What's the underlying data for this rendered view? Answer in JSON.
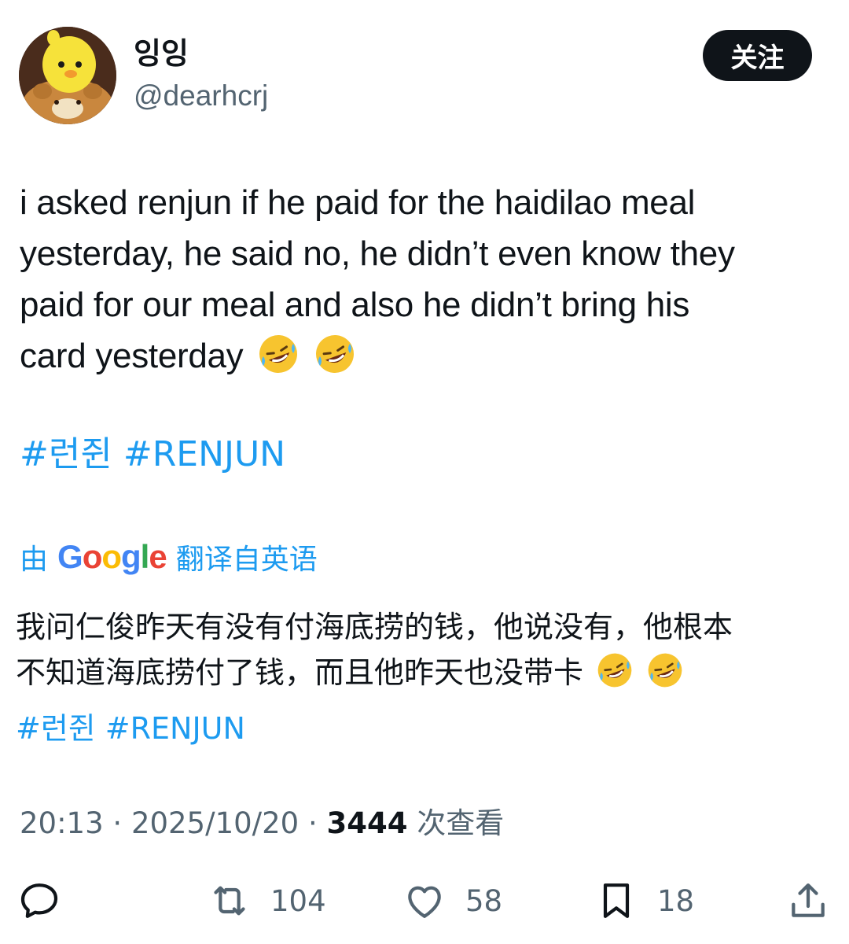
{
  "user": {
    "display_name": "잉잉",
    "handle": "@dearhcrj"
  },
  "follow_label": "关注",
  "tweet": {
    "lines": [
      "i asked renjun if he paid for the haidilao meal",
      "yesterday, he said no, he didn’t even know they",
      "paid for our meal and also he didn’t bring his",
      "card yesterday"
    ],
    "hashtags": [
      "#런쥔",
      "#RENJUN"
    ]
  },
  "translation": {
    "prefix": "由",
    "logo_letters": [
      "G",
      "o",
      "o",
      "g",
      "l",
      "e"
    ],
    "suffix": "翻译自英语",
    "lines": [
      "我问仁俊昨天有没有付海底捞的钱，他说没有，他根本",
      "不知道海底捞付了钱，而且他昨天也没带卡"
    ],
    "hashtags": [
      "#런쥔",
      "#RENJUN"
    ]
  },
  "meta": {
    "time": "20:13",
    "separator": " · ",
    "date": "2025/10/20",
    "views": "3444",
    "views_label": "次查看"
  },
  "actions": {
    "reply_count": "",
    "retweet_count": "104",
    "like_count": "58",
    "bookmark_count": "18"
  },
  "colors": {
    "accent": "#1d9bf0",
    "text": "#0f1419",
    "muted": "#536471"
  },
  "icons": [
    "avatar-image",
    "rofl-emoji",
    "reply-icon",
    "retweet-icon",
    "like-icon",
    "bookmark-icon",
    "share-icon"
  ]
}
